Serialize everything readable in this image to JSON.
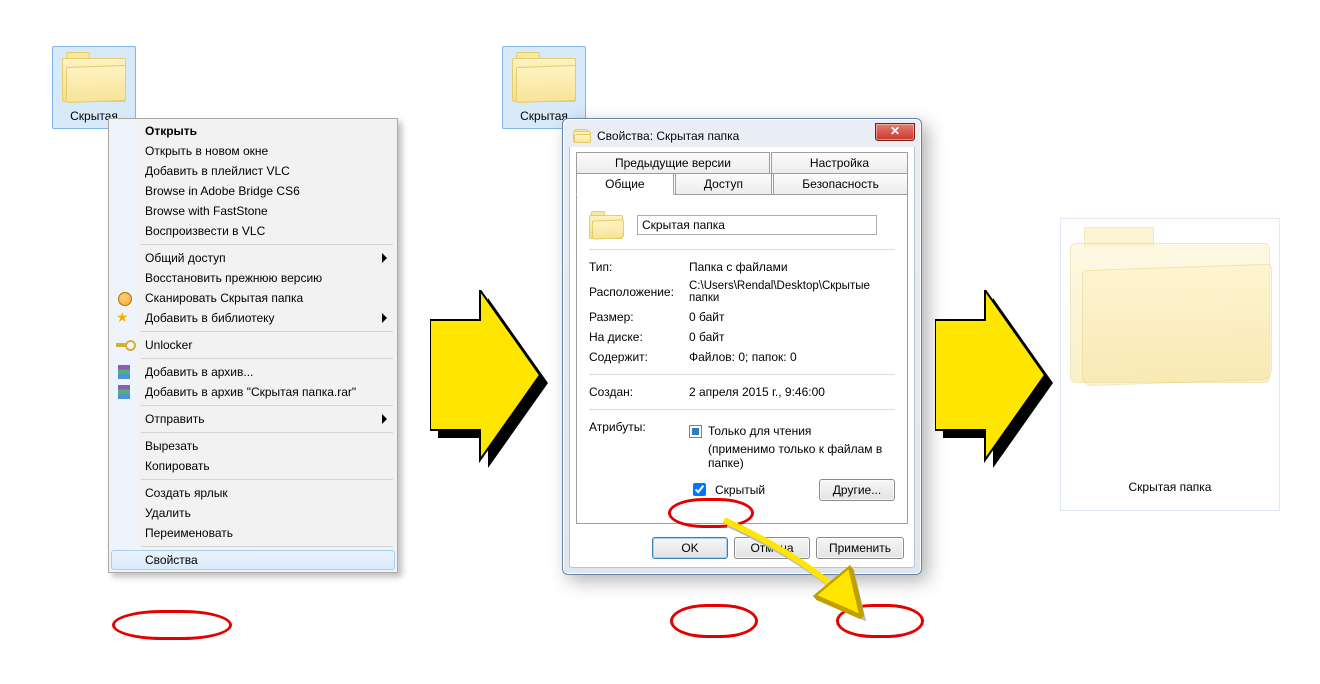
{
  "desktop": {
    "folder1_label": "Скрытая",
    "folder2_label": "Скрытая",
    "folder3_label": "Скрытая папка"
  },
  "context_menu": {
    "open": "Открыть",
    "open_new_window": "Открыть в новом окне",
    "add_vlc_playlist": "Добавить в плейлист VLC",
    "browse_bridge": "Browse in Adobe Bridge CS6",
    "browse_faststone": "Browse with FastStone",
    "play_vlc": "Воспроизвести в VLC",
    "share": "Общий доступ",
    "restore_prev": "Восстановить прежнюю версию",
    "scan": "Сканировать Скрытая папка",
    "add_library": "Добавить в библиотеку",
    "unlocker": "Unlocker",
    "add_archive": "Добавить в архив...",
    "add_archive_named": "Добавить в архив \"Скрытая папка.rar\"",
    "send_to": "Отправить",
    "cut": "Вырезать",
    "copy": "Копировать",
    "create_shortcut": "Создать ярлык",
    "delete": "Удалить",
    "rename": "Переименовать",
    "properties": "Свойства"
  },
  "dialog": {
    "title": "Свойства: Скрытая папка",
    "tabs_top": {
      "prev_versions": "Предыдущие версии",
      "customize": "Настройка"
    },
    "tabs_bottom": {
      "general": "Общие",
      "access": "Доступ",
      "security": "Безопасность"
    },
    "name_value": "Скрытая папка",
    "type_k": "Тип:",
    "type_v": "Папка с файлами",
    "location_k": "Расположение:",
    "location_v": "C:\\Users\\Rendal\\Desktop\\Скрытые папки",
    "size_k": "Размер:",
    "size_v": "0 байт",
    "ondisk_k": "На диске:",
    "ondisk_v": "0 байт",
    "contains_k": "Содержит:",
    "contains_v": "Файлов: 0; папок: 0",
    "created_k": "Создан:",
    "created_v": "2 апреля 2015 г., 9:46:00",
    "attrib_k": "Атрибуты:",
    "readonly_label": "Только для чтения",
    "readonly_note": "(применимо только к файлам в папке)",
    "hidden_label": "Скрытый",
    "other_btn": "Другие...",
    "ok": "OK",
    "cancel": "Отмена",
    "apply": "Применить"
  }
}
